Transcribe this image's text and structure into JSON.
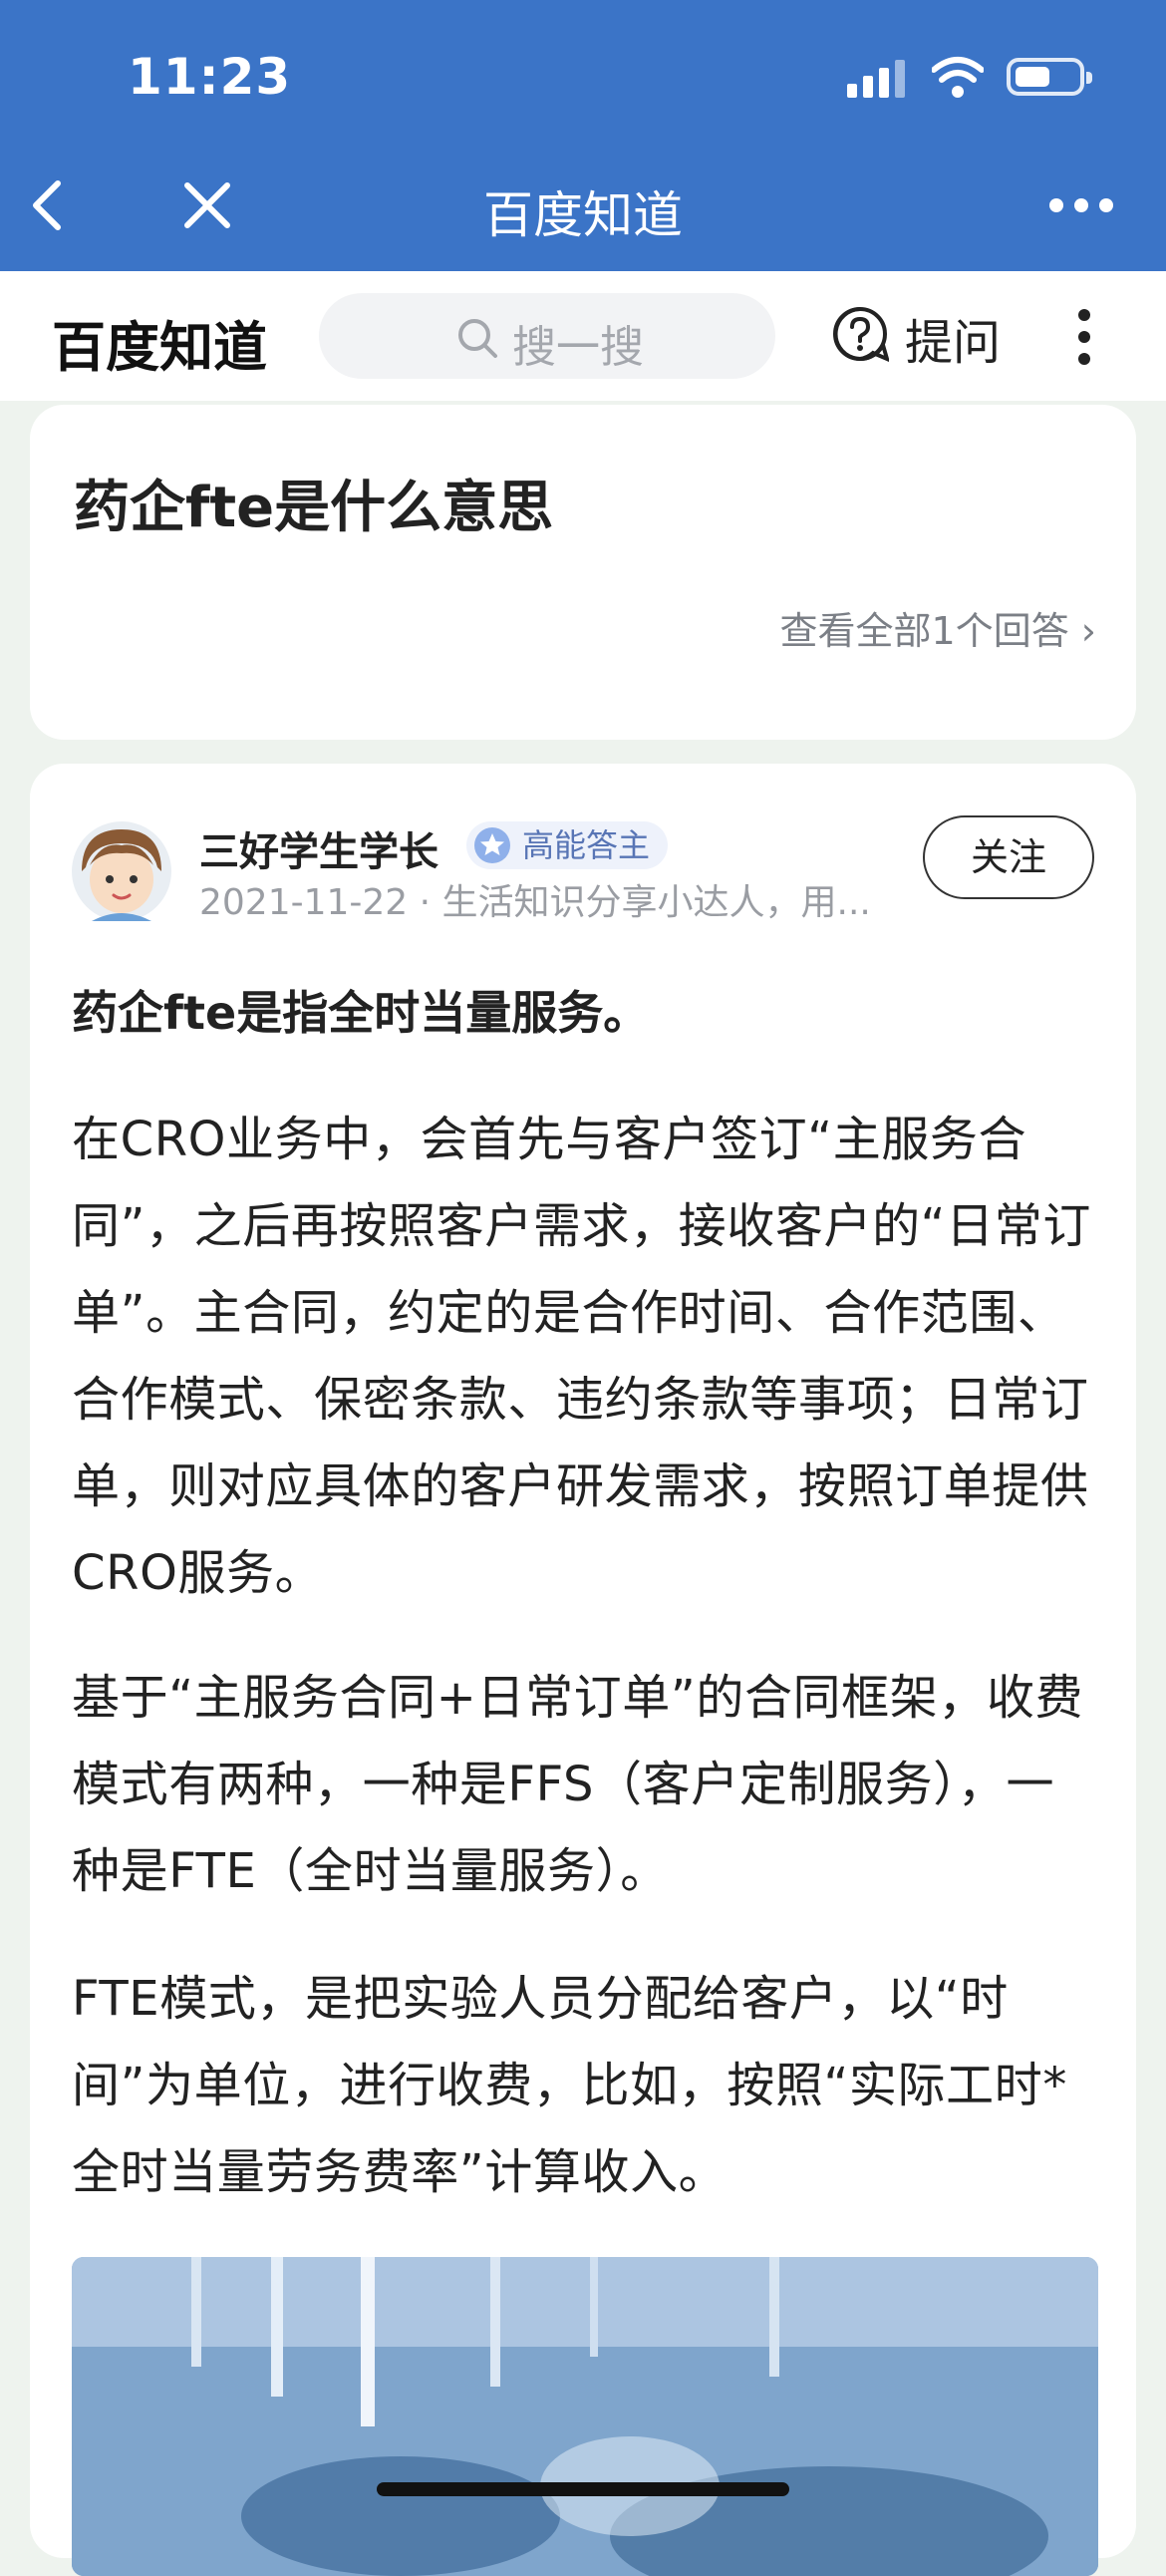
{
  "status": {
    "time": "11:23"
  },
  "nav": {
    "title": "百度知道"
  },
  "header": {
    "logo": "百度知道",
    "search_placeholder": "搜一搜",
    "ask_label": "提问"
  },
  "question": {
    "title": "药企fte是什么意思",
    "all_answers": "查看全部1个回答"
  },
  "answer": {
    "author": "三好学生学长",
    "badge": "高能答主",
    "meta": "2021-11-22 · 生活知识分享小达人，用...",
    "follow_label": "关注",
    "lead": "药企fte是指全时当量服务。",
    "paragraphs": [
      "在CRO业务中，会首先与客户签订“主服务合同”，之后再按照客户需求，接收客户的“日常订单”。主合同，约定的是合作时间、合作范围、合作模式、保密条款、违约条款等事项；日常订单，则对应具体的客户研发需求，按照订单提供CRO服务。",
      "基于“主服务合同+日常订单”的合同框架，收费模式有两种，一种是FFS（客户定制服务），一种是FTE（全时当量服务）。",
      "FTE模式，是把实验人员分配给客户，以“时间”为单位，进行收费，比如，按照“实际工时*全时当量劳务费率”计算收入。"
    ]
  },
  "colors": {
    "brand_blue": "#3b74c7",
    "badge_blue": "#5875b5"
  }
}
